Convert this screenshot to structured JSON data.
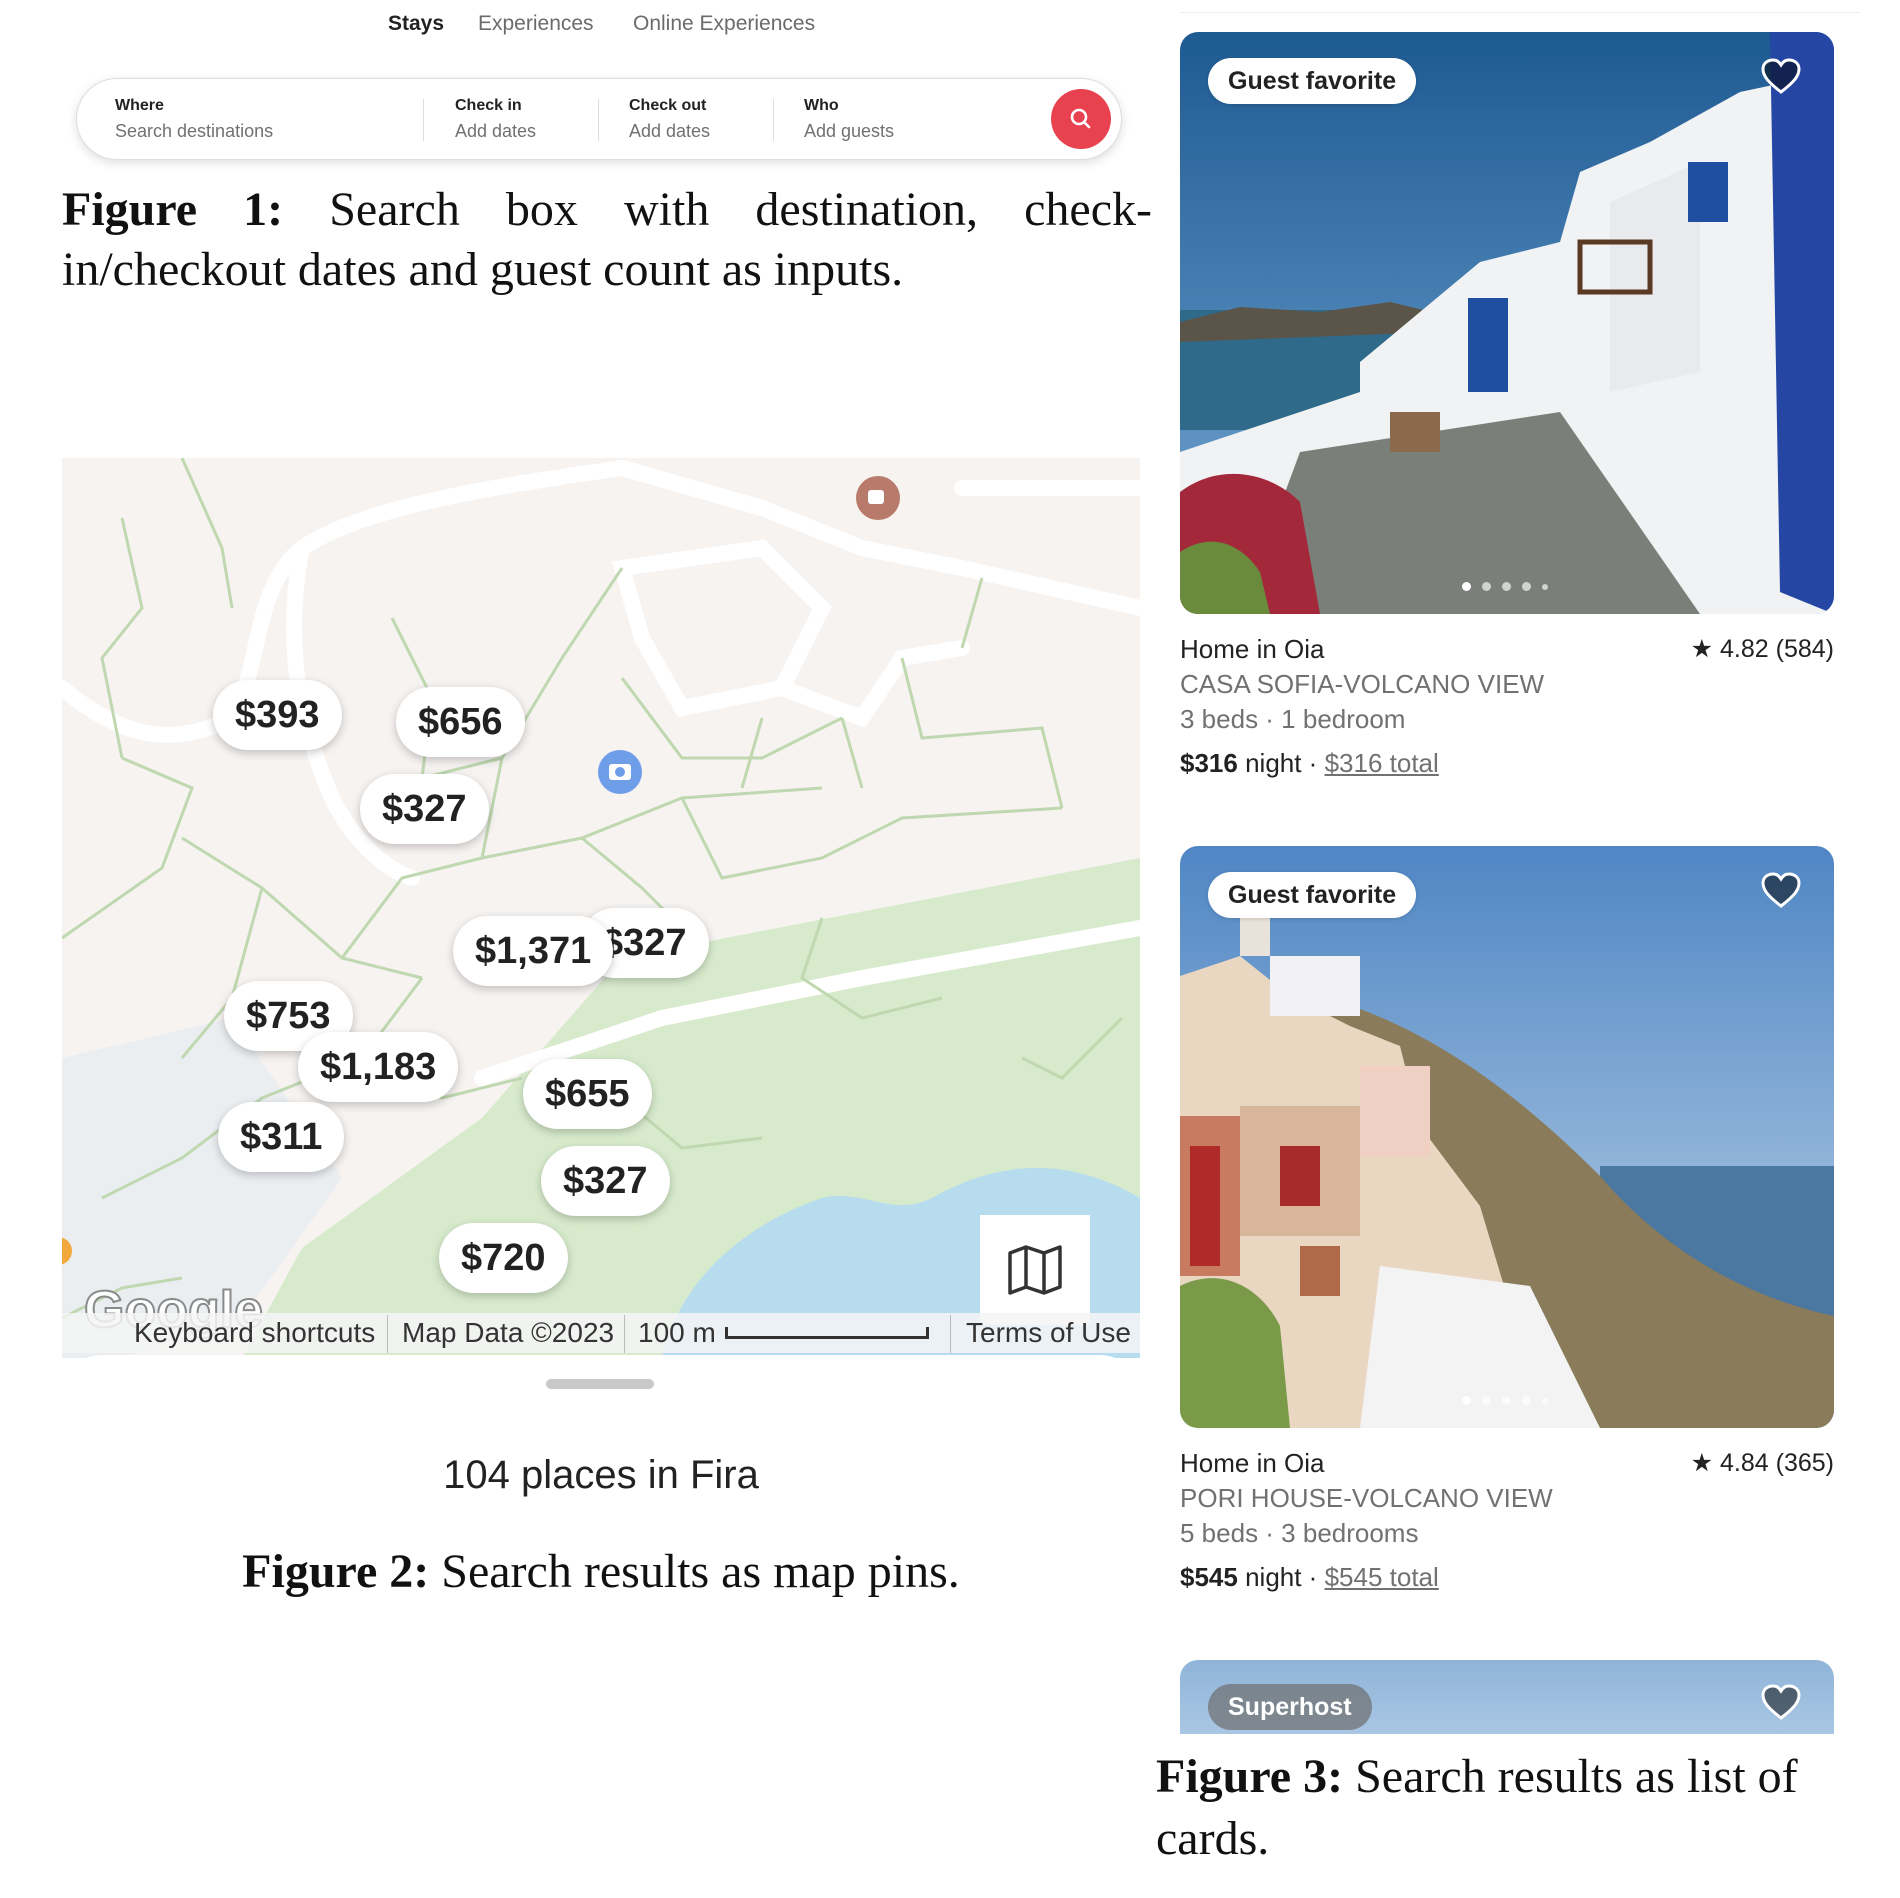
{
  "figure1": {
    "tabs": [
      "Stays",
      "Experiences",
      "Online Experiences"
    ],
    "where_label": "Where",
    "where_placeholder": "Search destinations",
    "checkin_label": "Check in",
    "checkin_placeholder": "Add dates",
    "checkout_label": "Check out",
    "checkout_placeholder": "Add dates",
    "who_label": "Who",
    "who_placeholder": "Add guests",
    "search_icon": "search-icon",
    "accent_color": "#e8414f",
    "caption_label": "Figure 1:",
    "caption_line1": "Search box with destination, check-",
    "caption_line2": "in/checkout dates and guest count as inputs."
  },
  "figure2": {
    "pins": [
      "$393",
      "$656",
      "$327",
      "$1,371",
      "$327",
      "$753",
      "$1,183",
      "$311",
      "$655",
      "$327",
      "$720"
    ],
    "map_logo": "Google",
    "keyboard_shortcuts": "Keyboard shortcuts",
    "map_data": "Map Data ©2023",
    "scale": "100 m",
    "terms": "Terms of Use",
    "places_count": "104 places in Fira",
    "map_toggle_icon": "map-icon",
    "caption_label": "Figure 2:",
    "caption_text": "Search results as map pins."
  },
  "figure3": {
    "cards": [
      {
        "badge": "Guest favorite",
        "title": "Home in Oia",
        "rating": "4.82 (584)",
        "name": "CASA SOFIA-VOLCANO VIEW",
        "beds": "3 beds · 1 bedroom",
        "price": "$316",
        "price_unit": "night ·",
        "total": "$316 total"
      },
      {
        "badge": "Guest favorite",
        "title": "Home in Oia",
        "rating": "4.84 (365)",
        "name": "PORI HOUSE-VOLCANO VIEW",
        "beds": "5 beds · 3 bedrooms",
        "price": "$545",
        "price_unit": "night ·",
        "total": "$545 total"
      }
    ],
    "third_badge": "Superhost",
    "caption_label": "Figure 3:",
    "caption_line1": "Search results as list of",
    "caption_line2": "cards."
  }
}
